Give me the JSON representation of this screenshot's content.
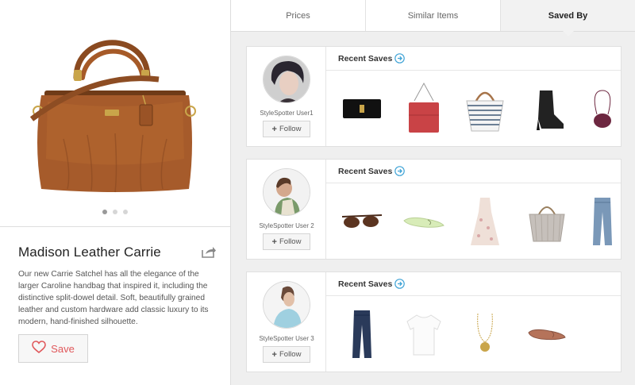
{
  "product": {
    "title": "Madison Leather Carrie",
    "description": "Our new Carrie Satchel has all the elegance of the larger Caroline handbag that inspired it, including the distinctive split-dowel detail. Soft, beautifully grained leather and custom hardware add classic luxury to its modern, hand-finished silhouette.",
    "save_label": "Save",
    "carousel_dots": 3,
    "carousel_active": 1
  },
  "tabs": [
    {
      "label": "Prices",
      "active": false
    },
    {
      "label": "Similar Items",
      "active": false
    },
    {
      "label": "Saved By",
      "active": true
    }
  ],
  "users": [
    {
      "name": "StyleSpotter User1",
      "follow_label": "Follow",
      "recent_label": "Recent Saves",
      "items": [
        "black-clutch",
        "red-handbag",
        "striped-tote",
        "black-ankle-boot",
        "purple-crossbody"
      ]
    },
    {
      "name": "StyleSpotter User 2",
      "follow_label": "Follow",
      "recent_label": "Recent Saves",
      "items": [
        "sunglasses",
        "mint-flat",
        "floral-dress",
        "grey-tote",
        "jeans"
      ]
    },
    {
      "name": "StyleSpotter User 3",
      "follow_label": "Follow",
      "recent_label": "Recent Saves",
      "items": [
        "dark-jeans",
        "white-tshirt",
        "gold-pendant",
        "brown-flat"
      ]
    }
  ],
  "colors": {
    "accent": "#3fa3d6",
    "heart": "#e0585b",
    "leather": "#9a5326"
  }
}
